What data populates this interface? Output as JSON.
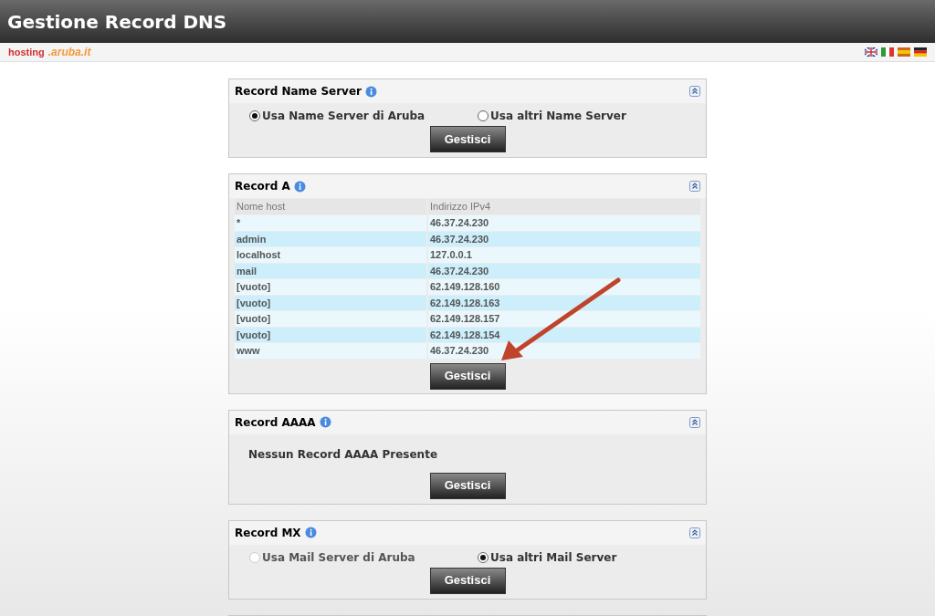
{
  "window": {
    "title": "Gestione Record DNS"
  },
  "brand": {
    "word": "hosting",
    "logo": ".aruba.it"
  },
  "sections": [
    {
      "kind": "radio",
      "title": "Record Name Server",
      "options": [
        {
          "label": "Usa Name Server di Aruba",
          "selected": true,
          "disabled": false
        },
        {
          "label": "Usa altri Name Server",
          "selected": false,
          "disabled": false
        }
      ],
      "button": "Gestisci"
    },
    {
      "kind": "table",
      "title": "Record A",
      "columns": [
        "Nome host",
        "Indirizzo IPv4"
      ],
      "rows": [
        [
          "*",
          "46.37.24.230"
        ],
        [
          "admin",
          "46.37.24.230"
        ],
        [
          "localhost",
          "127.0.0.1"
        ],
        [
          "mail",
          "46.37.24.230"
        ],
        [
          "[vuoto]",
          "62.149.128.160"
        ],
        [
          "[vuoto]",
          "62.149.128.163"
        ],
        [
          "[vuoto]",
          "62.149.128.157"
        ],
        [
          "[vuoto]",
          "62.149.128.154"
        ],
        [
          "www",
          "46.37.24.230"
        ]
      ],
      "button": "Gestisci"
    },
    {
      "kind": "empty",
      "title": "Record AAAA",
      "message": "Nessun Record AAAA Presente",
      "button": "Gestisci"
    },
    {
      "kind": "radio",
      "title": "Record MX",
      "options": [
        {
          "label": "Usa Mail Server di Aruba",
          "selected": false,
          "disabled": true
        },
        {
          "label": "Usa altri Mail Server",
          "selected": true,
          "disabled": false
        }
      ],
      "button": "Gestisci"
    },
    {
      "kind": "cut"
    }
  ]
}
